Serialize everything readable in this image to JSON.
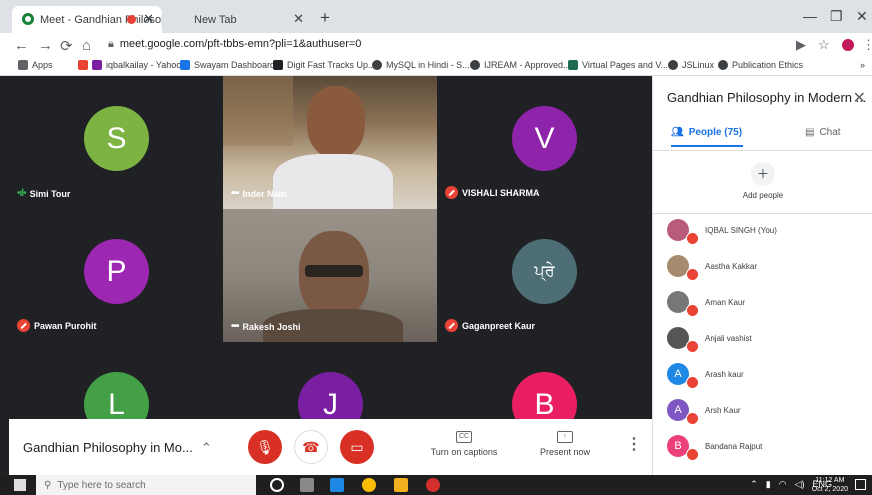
{
  "browser": {
    "tabs": [
      {
        "title": "Meet - Gandhian Philosophy",
        "active": true
      },
      {
        "title": "New Tab",
        "active": false
      }
    ],
    "url": "meet.google.com/pft-tbbs-emn?pli=1&authuser=0",
    "bookmarks": [
      {
        "label": "Apps",
        "color": "#5f6368"
      },
      {
        "label": "iqbalkailay - Yahoo...",
        "color": "#7b1fa2"
      },
      {
        "label": "Swayam Dashboard",
        "color": "#1a73e8"
      },
      {
        "label": "Digit Fast Tracks Up...",
        "color": "#202124"
      },
      {
        "label": "MySQL in Hindi - S...",
        "color": "#3c4043"
      },
      {
        "label": "IJREAM - Approved...",
        "color": "#3c4043"
      },
      {
        "label": "Virtual Pages and V...",
        "color": "#1e6b52"
      },
      {
        "label": "JSLinux",
        "color": "#3c4043"
      },
      {
        "label": "Publication Ethics",
        "color": "#3c4043"
      }
    ]
  },
  "tiles": [
    {
      "name": "Simi Tour",
      "initial": "S",
      "color": "#7cb342",
      "speaking": true
    },
    {
      "name": "Inder Nain",
      "initial": "",
      "color": "#6d5a45",
      "video": true,
      "speaking": true
    },
    {
      "name": "VISHALI SHARMA",
      "initial": "V",
      "color": "#8e24aa",
      "muted": true
    },
    {
      "name": "Pawan Purohit",
      "initial": "P",
      "color": "#9c27b0",
      "muted": true
    },
    {
      "name": "Rakesh Joshi",
      "initial": "",
      "color": "#6e6a63",
      "video": true,
      "speaking": true
    },
    {
      "name": "Gaganpreet Kaur",
      "initial": "ਪ੍ਰੇ",
      "color": "#4e6e75",
      "muted": true
    },
    {
      "name": "",
      "initial": "L",
      "color": "#43a047"
    },
    {
      "name": "",
      "initial": "J",
      "color": "#7b1fa2"
    },
    {
      "name": "",
      "initial": "B",
      "color": "#e91e63"
    }
  ],
  "controls": {
    "meeting_title": "Gandhian Philosophy in Mo...",
    "captions_label": "Turn on captions",
    "captions_icon": "CC",
    "present_label": "Present now"
  },
  "sidepanel": {
    "title": "Gandhian Philosophy in Modern ...",
    "people_tab": "People (75)",
    "chat_tab": "Chat",
    "add_people": "Add people",
    "people": [
      {
        "name": "IQBAL SINGH (You)",
        "initial": "",
        "color": "#b85c7a"
      },
      {
        "name": "Aastha Kakkar",
        "initial": "",
        "color": "#a58a6e"
      },
      {
        "name": "Aman Kaur",
        "initial": "",
        "color": "#777777"
      },
      {
        "name": "Anjali vashist",
        "initial": "",
        "color": "#555555"
      },
      {
        "name": "Arash kaur",
        "initial": "A",
        "color": "#1e88e5"
      },
      {
        "name": "Arsh Kaur",
        "initial": "A",
        "color": "#7e57c2"
      },
      {
        "name": "Bandana Rajput",
        "initial": "B",
        "color": "#ec407a"
      }
    ]
  },
  "taskbar": {
    "search_placeholder": "Type here to search",
    "lang": "ENG",
    "time": "11:12 AM",
    "date": "Oct 2, 2020"
  }
}
